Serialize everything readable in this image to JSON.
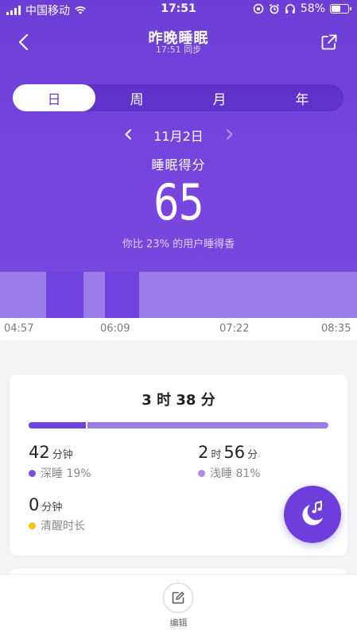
{
  "status_bar": {
    "carrier": "中国移动",
    "time": "17:51",
    "battery_text": "58%",
    "battery_level": 0.58
  },
  "nav": {
    "title": "昨晚睡眠",
    "sync_text": "17:51 同步"
  },
  "tabs": [
    {
      "label": "日",
      "active": true
    },
    {
      "label": "周",
      "active": false
    },
    {
      "label": "月",
      "active": false
    },
    {
      "label": "年",
      "active": false
    }
  ],
  "date": {
    "label": "11月2日"
  },
  "score": {
    "label": "睡眠得分",
    "value": "65",
    "compare_text": "你比 23% 的用户睡得香"
  },
  "timeline": {
    "start": "04:57",
    "end": "08:35",
    "ticks": [
      "04:57",
      "06:09",
      "07:22",
      "08:35"
    ],
    "deep_segments": [
      {
        "from": "05:25",
        "to": "05:48"
      },
      {
        "from": "06:01",
        "to": "06:22"
      }
    ],
    "colors": {
      "light": "#9b7de9",
      "deep": "#6f43dd"
    }
  },
  "summary": {
    "total_hours": "3",
    "hour_unit": "时",
    "total_minutes": "38",
    "minute_unit": "分",
    "deep_fraction": 0.19,
    "deep": {
      "value": "42",
      "unit": "分钟",
      "label": "深睡 19%",
      "color": "#7b4fe0"
    },
    "light": {
      "hours": "2",
      "hour_unit": "时",
      "minutes": "56",
      "minute_unit": "分",
      "label": "浅睡 81%",
      "color": "#a98bec"
    },
    "awake": {
      "value": "0",
      "unit": "分钟",
      "label": "清醒时长",
      "color": "#f5c518"
    }
  },
  "fab": {
    "icon": "moon-music-icon"
  },
  "bottom": {
    "edit_label": "编辑",
    "icon": "edit-icon"
  }
}
